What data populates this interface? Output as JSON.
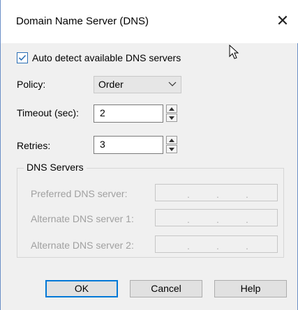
{
  "dialog": {
    "title": "Domain Name Server (DNS)",
    "close_label": "✕"
  },
  "auto_detect": {
    "label": "Auto detect available DNS servers",
    "checked": true
  },
  "policy": {
    "label": "Policy:",
    "value": "Order"
  },
  "timeout": {
    "label": "Timeout (sec):",
    "value": "2"
  },
  "retries": {
    "label": "Retries:",
    "value": "3"
  },
  "dns_servers": {
    "group_title": "DNS Servers",
    "preferred_label": "Preferred DNS server:",
    "alternate1_label": "Alternate DNS server 1:",
    "alternate2_label": "Alternate DNS server 2:",
    "ip_separator": "."
  },
  "buttons": {
    "ok": "OK",
    "cancel": "Cancel",
    "help": "Help"
  },
  "colors": {
    "accent": "#0078d7",
    "window_border": "#6b8fc7",
    "disabled_text": "#a0a0a0"
  }
}
